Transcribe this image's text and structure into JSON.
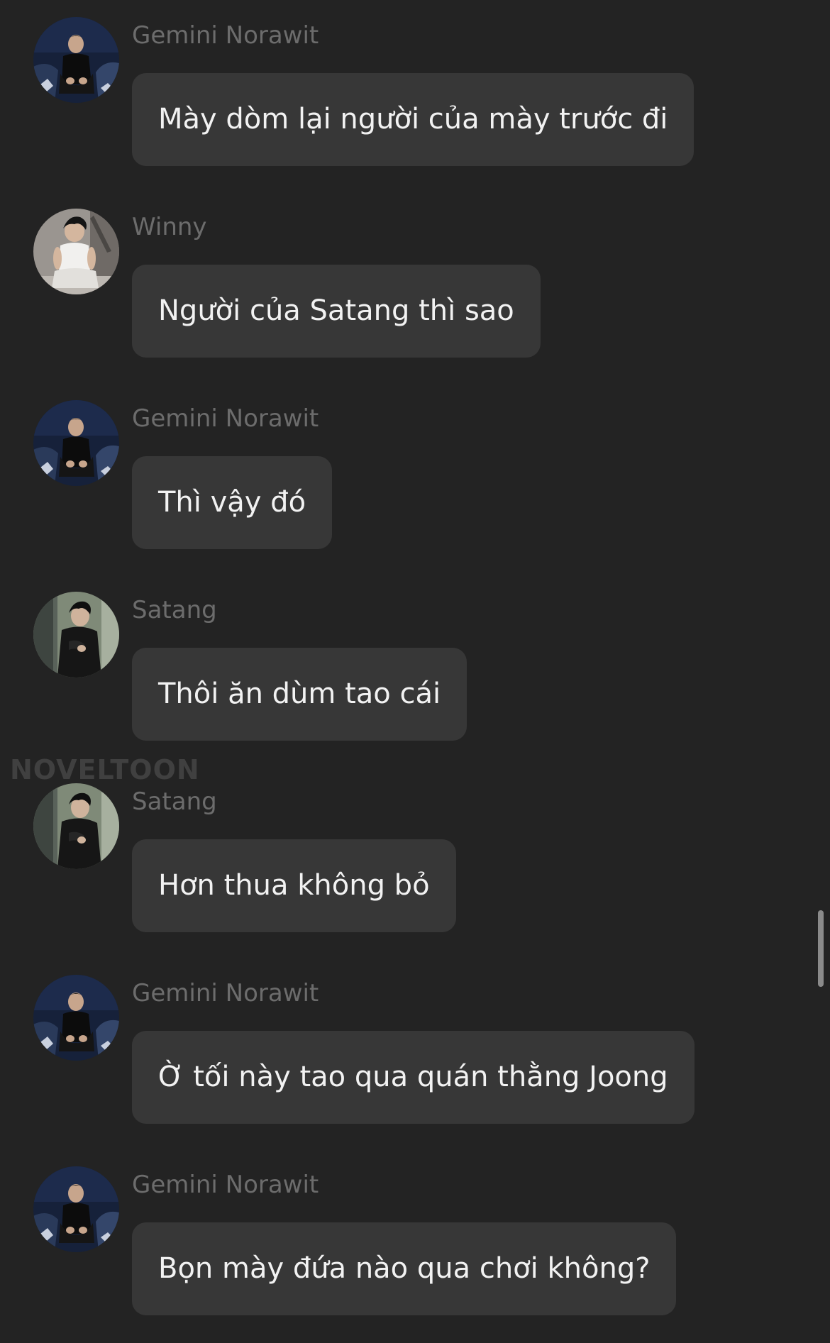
{
  "watermark": "NOVELTOON",
  "colors": {
    "background": "#232323",
    "bubble": "#373737",
    "sender_name": "#6c6c6c",
    "message_text": "#f2f2f2"
  },
  "messages": [
    {
      "sender": "Gemini Norawit",
      "avatar": "avatar-gemini",
      "text": "Mày dòm lại người của mày trước đi"
    },
    {
      "sender": "Winny",
      "avatar": "avatar-winny",
      "text": "Người của Satang thì sao"
    },
    {
      "sender": "Gemini Norawit",
      "avatar": "avatar-gemini",
      "text": "Thì vậy đó"
    },
    {
      "sender": "Satang",
      "avatar": "avatar-satang",
      "text": "Thôi ăn dùm tao cái"
    },
    {
      "sender": "Satang",
      "avatar": "avatar-satang",
      "text": "Hơn thua không bỏ"
    },
    {
      "sender": "Gemini Norawit",
      "avatar": "avatar-gemini",
      "text": "Ờ tối này tao qua quán thằng Joong"
    },
    {
      "sender": "Gemini Norawit",
      "avatar": "avatar-gemini",
      "text": "Bọn mày đứa nào qua chơi không?"
    }
  ]
}
